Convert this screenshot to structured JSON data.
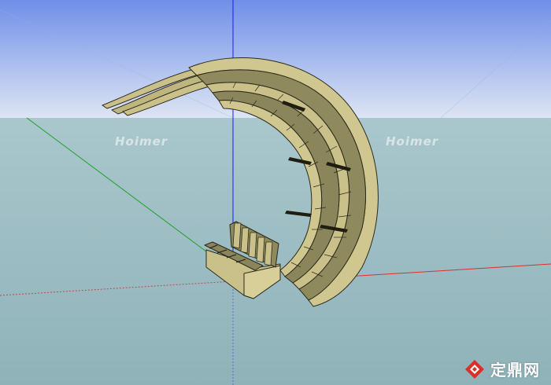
{
  "scene": {
    "sky_top_color": "#6f8fe8",
    "sky_bottom_color": "#dbe4f4",
    "ground_color": "#a8c6cc",
    "model_color": "#c9c08a",
    "model_inner_color": "#8f8a5e",
    "axis_blue": "#1a1aff",
    "axis_red": "#d9302c",
    "axis_green": "#1fa02a"
  },
  "watermarks": {
    "left": "Hoimer",
    "right": "Hoimer"
  },
  "brand": {
    "text": "定鼎网"
  }
}
